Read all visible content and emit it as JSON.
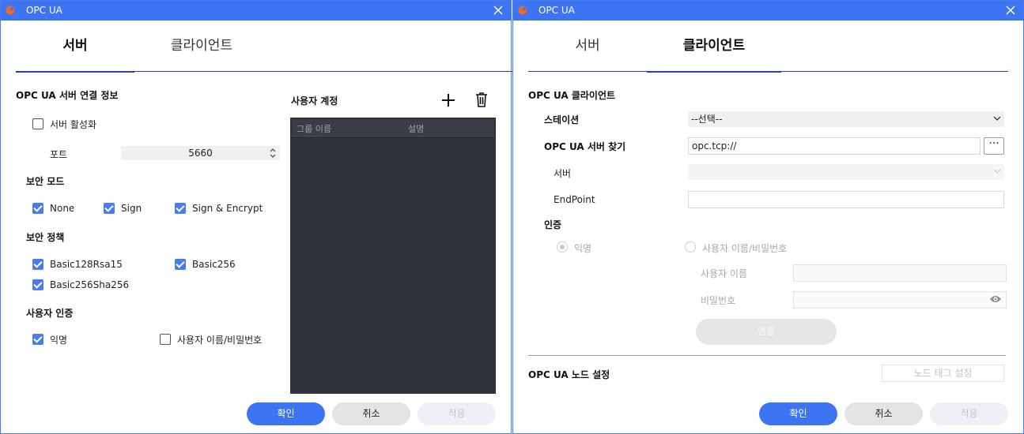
{
  "colors": {
    "accent": "#3d74f2",
    "tab_underline": "#2f3ea8",
    "table_bg": "#2e3138"
  },
  "server_window": {
    "title": "OPC UA",
    "tabs": [
      {
        "label": "서버",
        "active": true
      },
      {
        "label": "클라이언트",
        "active": false
      }
    ],
    "connection_info_title": "OPC UA 서버 연결 정보",
    "enable_server": {
      "label": "서버 활성화",
      "checked": false
    },
    "port": {
      "label": "포트",
      "value": "5660"
    },
    "security_mode": {
      "title": "보안 모드",
      "options": [
        {
          "label": "None",
          "checked": true
        },
        {
          "label": "Sign",
          "checked": true
        },
        {
          "label": "Sign & Encrypt",
          "checked": true
        }
      ]
    },
    "security_policy": {
      "title": "보안 정책",
      "options": [
        {
          "label": "Basic128Rsa15",
          "checked": true
        },
        {
          "label": "Basic256",
          "checked": true
        },
        {
          "label": "Basic256Sha256",
          "checked": true
        }
      ]
    },
    "user_auth": {
      "title": "사용자 인증",
      "options": [
        {
          "label": "익명",
          "checked": true
        },
        {
          "label": "사용자 이름/비밀번호",
          "checked": false
        }
      ]
    },
    "user_accounts": {
      "title": "사용자 계정",
      "columns": [
        "그룹 이름",
        "설명"
      ],
      "rows": []
    },
    "buttons": {
      "ok": "확인",
      "cancel": "취소",
      "apply": "적용"
    }
  },
  "client_window": {
    "title": "OPC UA",
    "tabs": [
      {
        "label": "서버",
        "active": false
      },
      {
        "label": "클라이언트",
        "active": true
      }
    ],
    "client_title": "OPC UA 클라이언트",
    "station": {
      "label": "스테이션",
      "value": "--선택--"
    },
    "find_server": {
      "label": "OPC UA 서버 찾기",
      "value": "opc.tcp://",
      "browse": "···"
    },
    "server": {
      "label": "서버",
      "value": ""
    },
    "endpoint": {
      "label": "EndPoint",
      "value": ""
    },
    "auth": {
      "title": "인증",
      "anonymous": "익명",
      "user_pass": "사용자 이름/비밀번호",
      "username_label": "사용자 이름",
      "password_label": "비밀번호",
      "connect": "연결"
    },
    "node_settings": {
      "title": "OPC UA 노드 설정",
      "button": "노드 태그 설정"
    },
    "buttons": {
      "ok": "확인",
      "cancel": "취소",
      "apply": "적용"
    }
  }
}
